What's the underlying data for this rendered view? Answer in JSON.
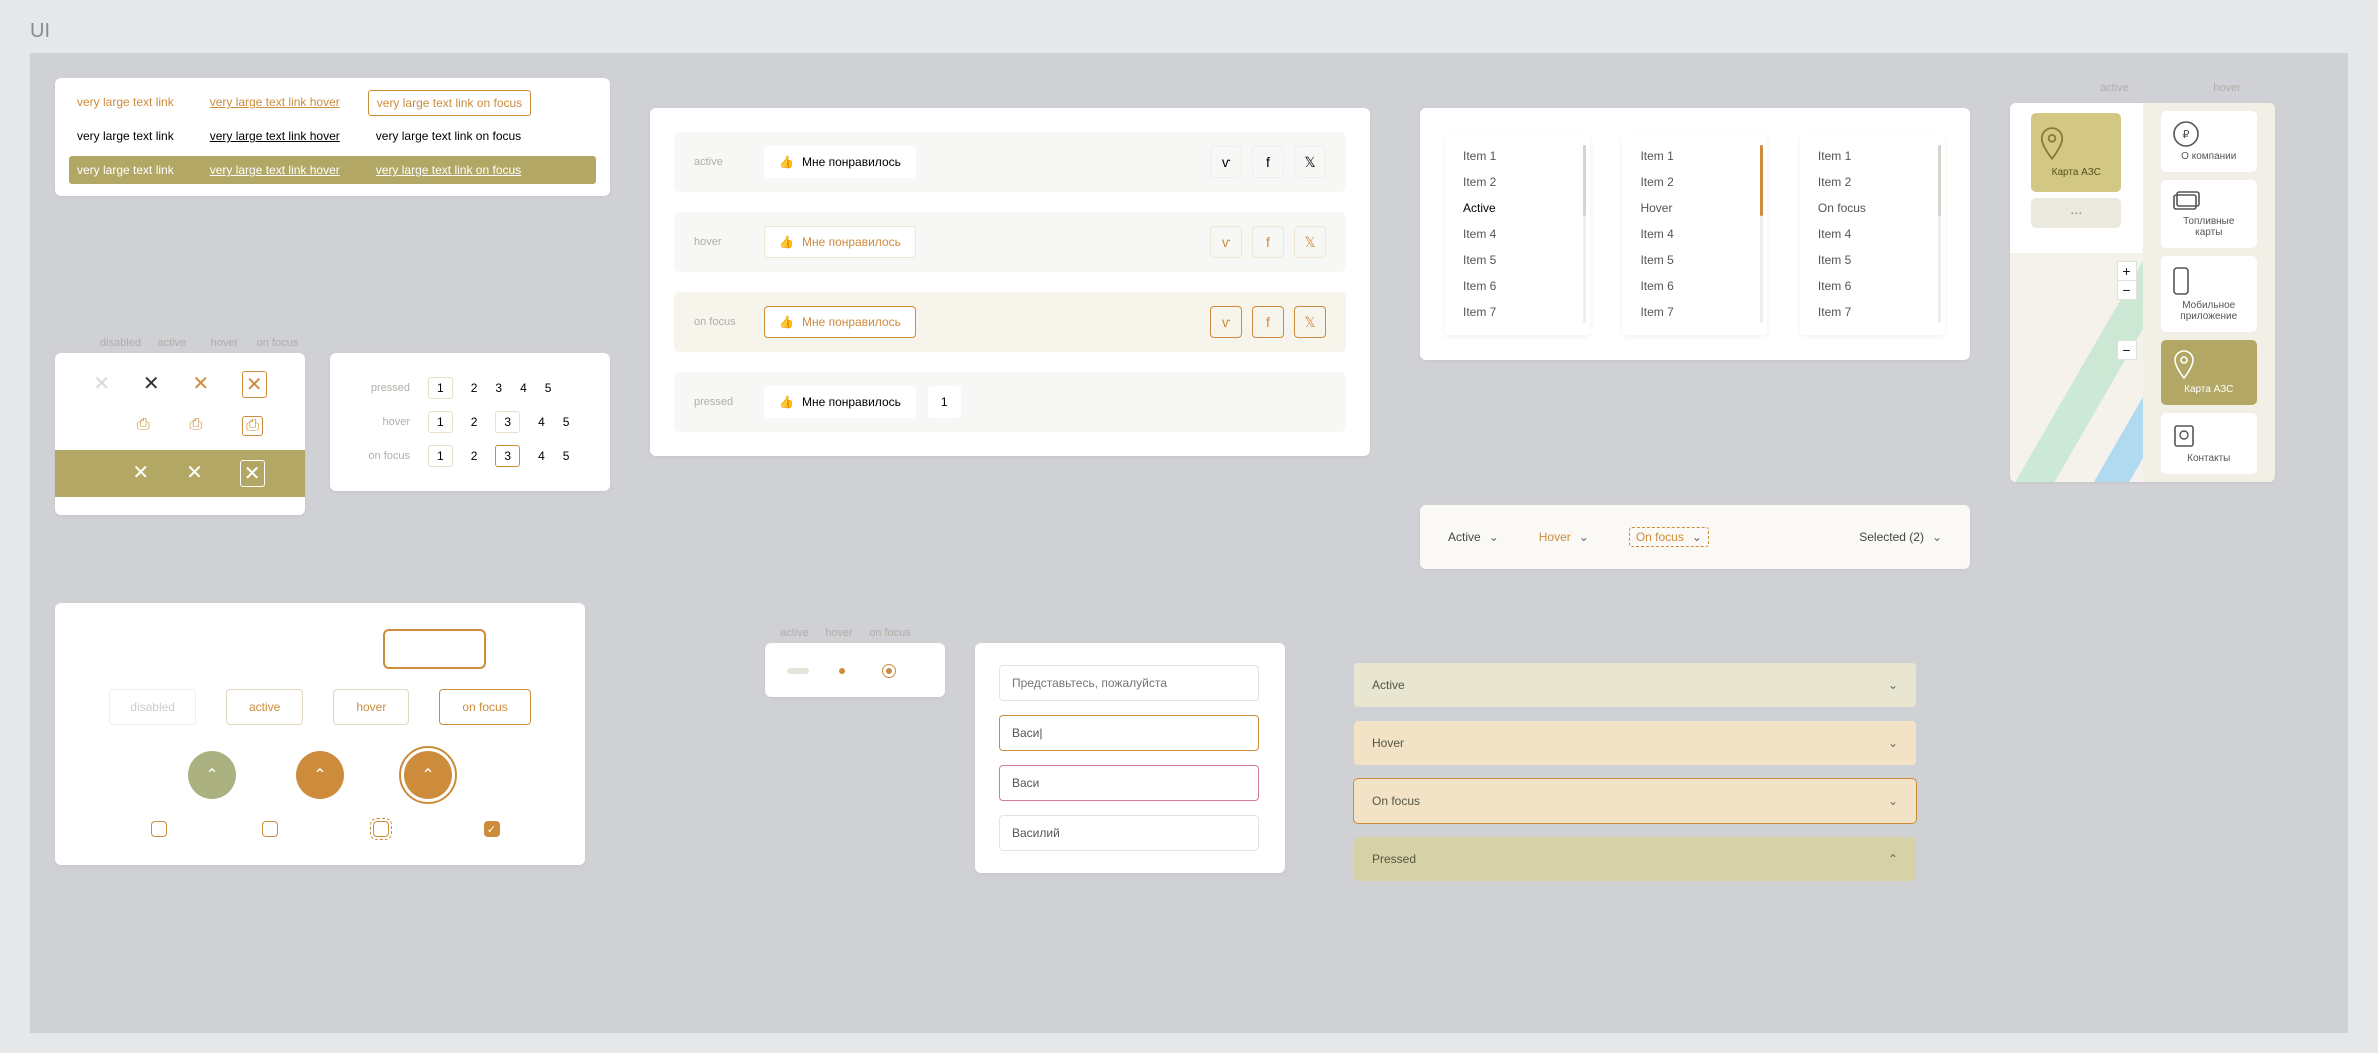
{
  "page_title": "UI",
  "col_labels": {
    "disabled": "disabled",
    "active": "active",
    "hover": "hover",
    "onfocus": "on focus"
  },
  "row_labels": {
    "pressed": "pressed",
    "hover": "hover",
    "onfocus": "on focus",
    "active": "active"
  },
  "text_links": {
    "base": "very large text link",
    "hover": "very large text link hover",
    "focus": "very large text link on focus"
  },
  "pager": {
    "items": [
      "1",
      "2",
      "3",
      "4",
      "5"
    ]
  },
  "like": {
    "label": "Мне понравилось",
    "count": "1"
  },
  "list_items": [
    "Item 1",
    "Item 2",
    "",
    "Item 4",
    "Item 5",
    "Item 6",
    "Item 7"
  ],
  "list_state": {
    "active": "Active",
    "hover": "Hover",
    "focus": "On focus"
  },
  "dropdown": {
    "active": "Active",
    "hover": "Hover",
    "focus": "On focus",
    "selected": "Selected (2)"
  },
  "buttons": {
    "active": "active",
    "hover": "hover",
    "focus": "on focus",
    "disabled": "disabled"
  },
  "inputs": {
    "placeholder": "Представьтесь, пожалуйста",
    "typing": "Васи|",
    "error": "Васи",
    "filled": "Василий"
  },
  "accordion": {
    "active": "Active",
    "hover": "Hover",
    "focus": "On focus",
    "pressed": "Pressed"
  },
  "nav_labels": {
    "active": "active",
    "hover": "hover"
  },
  "nav_items": {
    "map": "Карта АЗС",
    "about": "О компании",
    "cards": "Топливные карты",
    "mobile": "Мобильное приложение",
    "map2": "Карта АЗС",
    "contacts": "Контакты"
  },
  "colors": {
    "accent_orange": "#cc8c3c",
    "accent_green": "#b2a765",
    "accent_beige": "#e8d9b9"
  }
}
